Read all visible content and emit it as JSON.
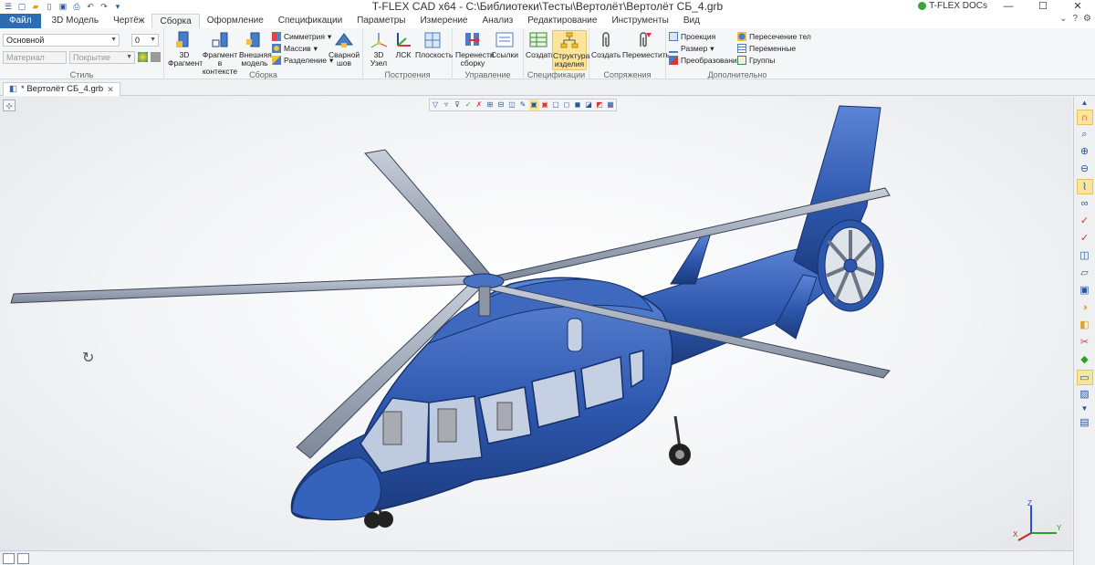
{
  "window": {
    "title": "T-FLEX CAD x64 - C:\\Библиотеки\\Тесты\\Вертолёт\\Вертолёт СБ_4.grb",
    "docs_label": "T-FLEX DOCs",
    "minimize": "—",
    "maximize": "☐",
    "close": "✕"
  },
  "tabs": [
    {
      "label": "Файл"
    },
    {
      "label": "3D Модель"
    },
    {
      "label": "Чертёж"
    },
    {
      "label": "Сборка"
    },
    {
      "label": "Оформление"
    },
    {
      "label": "Спецификации"
    },
    {
      "label": "Параметры"
    },
    {
      "label": "Измерение"
    },
    {
      "label": "Анализ"
    },
    {
      "label": "Редактирование"
    },
    {
      "label": "Инструменты"
    },
    {
      "label": "Вид"
    }
  ],
  "style_group": {
    "layer_value": "Основной",
    "number_value": "0",
    "material_placeholder": "Материал",
    "coating_placeholder": "Покрытие",
    "label": "Стиль"
  },
  "assembly_group": {
    "fragment3d": "3D Фрагмент",
    "fragment_context": "Фрагмент в контексте",
    "external_model": "Внешняя модель",
    "symmetry": "Симметрия",
    "array": "Массив",
    "split": "Разделение",
    "weld": "Сварной шов",
    "label": "Сборка"
  },
  "construction_group": {
    "node3d": "3D Узел",
    "lsk": "ЛСК",
    "planes": "Плоскость",
    "label": "Построения"
  },
  "control_group": {
    "move_assembly": "Перенести сборку",
    "links": "Ссылки",
    "label": "Управление"
  },
  "spec_group": {
    "create": "Создать",
    "structure": "Структура изделия",
    "label": "Спецификации"
  },
  "mates_group": {
    "create": "Создать",
    "move": "Переместить",
    "label": "Сопряжения"
  },
  "extra_group": {
    "projection": "Проекция",
    "size": "Размер",
    "transform": "Преобразование",
    "intersection": "Пересечение тел",
    "variables": "Переменные",
    "groups": "Группы",
    "label": "Дополнительно"
  },
  "document": {
    "tab_label": "* Вертолёт СБ_4.grb"
  },
  "axes": {
    "x": "X",
    "y": "Y",
    "z": "Z"
  },
  "colors": {
    "accent": "#2b6cb3",
    "highlight": "#fbe59a",
    "body": "#2d57ad"
  }
}
